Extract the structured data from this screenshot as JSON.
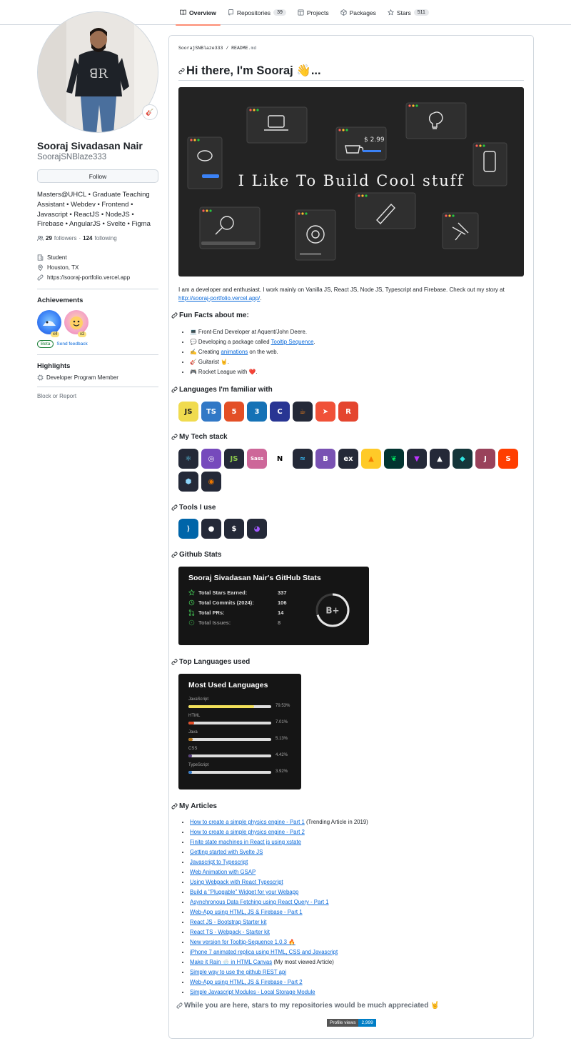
{
  "nav": {
    "tabs": [
      {
        "label": "Overview",
        "count": ""
      },
      {
        "label": "Repositories",
        "count": "39"
      },
      {
        "label": "Projects",
        "count": ""
      },
      {
        "label": "Packages",
        "count": ""
      },
      {
        "label": "Stars",
        "count": "511"
      }
    ]
  },
  "profile": {
    "status_emoji": "🎸",
    "name": "Sooraj Sivadasan Nair",
    "login": "SoorajSNBlaze333",
    "follow_label": "Follow",
    "bio": "Masters@UHCL • Graduate Teaching Assistant • Webdev • Frontend • Javascript • ReactJS • NodeJS • Firebase • AngularJS • Svelte • Figma",
    "followers": "29",
    "followers_label": "followers",
    "dot": "·",
    "following": "124",
    "following_label": "following",
    "org": "Student",
    "location": "Houston, TX",
    "website": "https://sooraj-portfolio.vercel.app",
    "achievements_title": "Achievements",
    "badge1_count": "x4",
    "badge2_count": "x2",
    "beta_label": "Beta",
    "feedback_label": "Send feedback",
    "highlights_title": "Highlights",
    "highlight_item": "Developer Program Member",
    "block_label": "Block or Report"
  },
  "readme": {
    "crumb_user": "SoorajSNBlaze333",
    "crumb_sep": "/",
    "crumb_file": "README",
    "crumb_ext": ".md",
    "title": "Hi there, I'm Sooraj 👋...",
    "banner_text": "I Like To Build Cool stuff",
    "banner_price": "$ 2.99",
    "intro": "I am a developer and enthusiast. I work mainly on Vanilla JS, React JS, Node JS, Typescript and Firebase. Check out my story at",
    "intro_link": "http://sooraj-portfolio.vercel.app/",
    "intro_end": ".",
    "fun_title": "Fun Facts about me:",
    "fun_facts": [
      {
        "pre": "💻 Front-End Developer at Aquent/John Deere.",
        "link": "",
        "post": ""
      },
      {
        "pre": "💬 Developing a package called ",
        "link": "Tooltip Sequence",
        "post": "."
      },
      {
        "pre": "✍ Creating ",
        "link": "animations",
        "post": " on the web."
      },
      {
        "pre": "🎸 Guitarist 🤘.",
        "link": "",
        "post": ""
      },
      {
        "pre": "🎮 Rocket League with ❤️.",
        "link": "",
        "post": ""
      }
    ],
    "languages_title": "Languages I'm familiar with",
    "languages": [
      {
        "name": "javascript-icon",
        "text": "JS",
        "bg": "#f0db4f",
        "fg": "#1f1f1f"
      },
      {
        "name": "typescript-icon",
        "text": "TS",
        "bg": "#3178c6",
        "fg": "#ffffff"
      },
      {
        "name": "html5-icon",
        "text": "5",
        "bg": "#e34f26",
        "fg": "#ffffff"
      },
      {
        "name": "css3-icon",
        "text": "3",
        "bg": "#1572b6",
        "fg": "#ffffff"
      },
      {
        "name": "c-icon",
        "text": "C",
        "bg": "#283593",
        "fg": "#ffffff"
      },
      {
        "name": "java-icon",
        "text": "☕",
        "bg": "#242938",
        "fg": "#f58219"
      },
      {
        "name": "swift-icon",
        "text": "➤",
        "bg": "#f05138",
        "fg": "#ffffff"
      },
      {
        "name": "rust-icon",
        "text": "R",
        "bg": "#e4452f",
        "fg": "#ffffff"
      }
    ],
    "tech_title": "My Tech stack",
    "tech": [
      {
        "name": "react-icon",
        "text": "⚛",
        "bg": "#242938",
        "fg": "#61dafb"
      },
      {
        "name": "redux-icon",
        "text": "◎",
        "bg": "#764abc",
        "fg": "#ffffff"
      },
      {
        "name": "nodejs-icon",
        "text": "JS",
        "bg": "#242938",
        "fg": "#8cc84b"
      },
      {
        "name": "sass-icon",
        "text": "Sass",
        "bg": "#cd6799",
        "fg": "#ffffff"
      },
      {
        "name": "nextjs-icon",
        "text": "N",
        "bg": "#ffffff",
        "fg": "#000000"
      },
      {
        "name": "tailwind-icon",
        "text": "≈",
        "bg": "#242938",
        "fg": "#38bdf8"
      },
      {
        "name": "bootstrap-icon",
        "text": "B",
        "bg": "#7952b3",
        "fg": "#ffffff"
      },
      {
        "name": "express-icon",
        "text": "ex",
        "bg": "#242938",
        "fg": "#ffffff"
      },
      {
        "name": "firebase-icon",
        "text": "▲",
        "bg": "#ffca28",
        "fg": "#f57c00"
      },
      {
        "name": "mongodb-icon",
        "text": "❦",
        "bg": "#023430",
        "fg": "#00ed64"
      },
      {
        "name": "vite-icon",
        "text": "▼",
        "bg": "#242938",
        "fg": "#bd34fe"
      },
      {
        "name": "vercel-icon",
        "text": "▲",
        "bg": "#242938",
        "fg": "#ffffff"
      },
      {
        "name": "netlify-icon",
        "text": "◆",
        "bg": "#14363a",
        "fg": "#32e6e2"
      },
      {
        "name": "jest-icon",
        "text": "J",
        "bg": "#99425b",
        "fg": "#ffffff"
      },
      {
        "name": "svelte-icon",
        "text": "S",
        "bg": "#ff3e00",
        "fg": "#ffffff"
      },
      {
        "name": "webpack-icon",
        "text": "⬢",
        "bg": "#242938",
        "fg": "#8ed6fb"
      },
      {
        "name": "blender-icon",
        "text": "◉",
        "bg": "#242938",
        "fg": "#ea7600"
      }
    ],
    "tools_title": "Tools I use",
    "tools": [
      {
        "name": "vscode-icon",
        "text": "⟩",
        "bg": "#0065a9",
        "fg": "#ffffff"
      },
      {
        "name": "github-icon",
        "text": "●",
        "bg": "#242938",
        "fg": "#ffffff"
      },
      {
        "name": "bash-icon",
        "text": "$",
        "bg": "#242938",
        "fg": "#ffffff"
      },
      {
        "name": "figma-icon",
        "text": "◕",
        "bg": "#242938",
        "fg": "#a259ff"
      }
    ],
    "stats_title": "Github Stats",
    "stats_card": {
      "title": "Sooraj Sivadasan Nair's GitHub Stats",
      "rows": [
        {
          "label": "Total Stars Earned:",
          "value": "337"
        },
        {
          "label": "Total Commits (2024):",
          "value": "106"
        },
        {
          "label": "Total PRs:",
          "value": "14"
        },
        {
          "label": "Total Issues:",
          "value": "8"
        }
      ],
      "grade": "B+",
      "grade_progress": 0.7
    },
    "toplang_title": "Top Languages used",
    "langs_card": {
      "title": "Most Used Languages",
      "items": [
        {
          "name": "JavaScript",
          "pct": "79.53%",
          "value": 79.53,
          "color": "#f1e05a"
        },
        {
          "name": "HTML",
          "pct": "7.01%",
          "value": 7.01,
          "color": "#e34c26"
        },
        {
          "name": "Java",
          "pct": "5.13%",
          "value": 5.13,
          "color": "#b07219"
        },
        {
          "name": "CSS",
          "pct": "4.42%",
          "value": 4.42,
          "color": "#563d7c"
        },
        {
          "name": "TypeScript",
          "pct": "3.92%",
          "value": 3.92,
          "color": "#3178c6"
        }
      ]
    },
    "articles_title": "My Articles",
    "articles": [
      {
        "link": "How to create a simple physics engine - Part 1",
        "post": " (Trending Article in 2019)"
      },
      {
        "link": "How to create a simple physics engine - Part 2",
        "post": ""
      },
      {
        "link": "Finite state machines in React js using xstate",
        "post": ""
      },
      {
        "link": "Getting started with Svelte JS",
        "post": ""
      },
      {
        "link": "Javascript to Typescript",
        "post": ""
      },
      {
        "link": "Web Animation with GSAP",
        "post": ""
      },
      {
        "link": "Using Webpack with React Typescript",
        "post": ""
      },
      {
        "link": "Build a \"Pluggable\" Widget for your Webapp",
        "post": ""
      },
      {
        "link": "Asynchronous Data Fetching using React Query - Part 1",
        "post": ""
      },
      {
        "link": "Web-App using HTML, JS & Firebase - Part 1",
        "post": ""
      },
      {
        "link": "React JS - Bootstrap Starter kit",
        "post": ""
      },
      {
        "link": "React TS - Webpack - Starter kit",
        "post": ""
      },
      {
        "link": "New version for Tooltip-Sequence 1.0.3 🔥",
        "post": ""
      },
      {
        "link": "iPhone 7 animated replica using HTML, CSS and Javascript",
        "post": ""
      },
      {
        "link": "Make it Rain 🌧️ in HTML Canvas",
        "post": " (My most viewed Article)"
      },
      {
        "link": "Simple way to use the github REST api",
        "post": ""
      },
      {
        "link": "Web-App using HTML, JS & Firebase - Part 2",
        "post": ""
      },
      {
        "link": "Simple Javascript Modules - Local Storage Module",
        "post": ""
      }
    ],
    "closing": "While you are here, stars to my repositories would be much appreciated 🤘",
    "views_label": "Profile views",
    "views_count": "2,999"
  }
}
